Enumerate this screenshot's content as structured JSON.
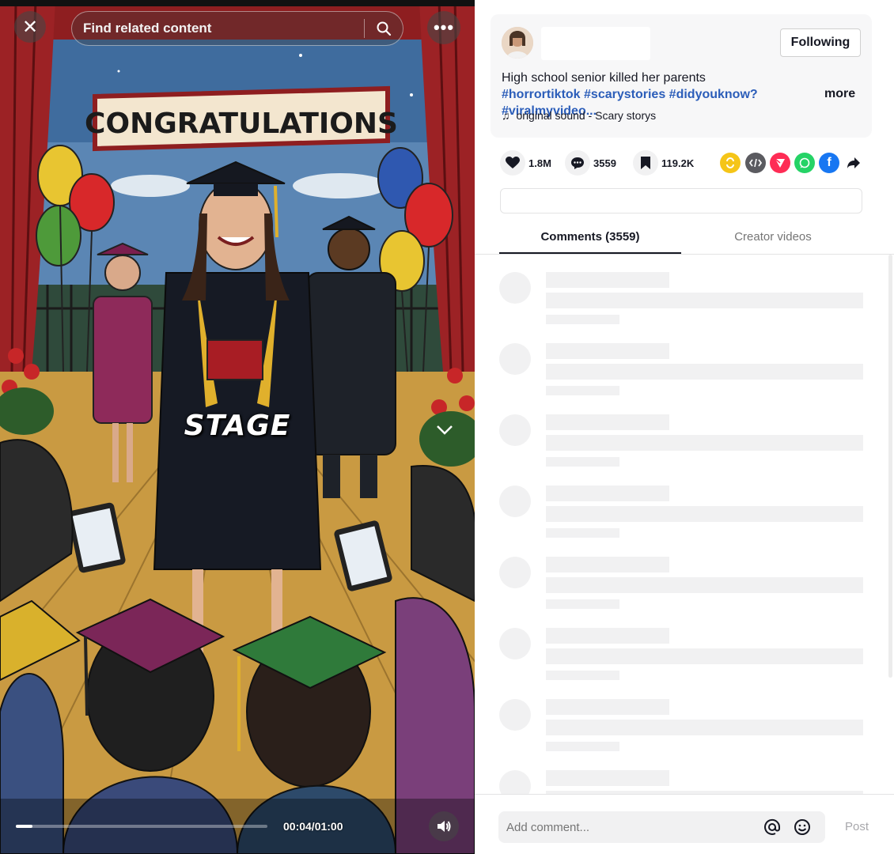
{
  "video": {
    "search_placeholder": "Find related content",
    "caption": "STAGE",
    "time": "00:04/01:00",
    "progress_fraction": 0.067,
    "banner_text": "CONGRATULATIONS",
    "icons": {
      "close": "close-icon",
      "search": "search-icon",
      "more": "more-options-icon",
      "chevron": "chevron-down-icon",
      "volume": "volume-icon"
    }
  },
  "post": {
    "follow_label": "Following",
    "description_text": "High school senior killed her parents ",
    "hashtags": [
      "#horrortiktok",
      "#scarystories",
      "#didyouknow?",
      "#viralmyvideo..."
    ],
    "more_label": "more",
    "music": "original sound - Scary storys",
    "likes": "1.8M",
    "comments": "3559",
    "saves": "119.2K",
    "share_icons": [
      "repost-icon",
      "embed-icon",
      "send-icon",
      "whatsapp-icon",
      "facebook-icon",
      "share-arrow-icon"
    ]
  },
  "tabs": {
    "comments_label": "Comments (3559)",
    "creator_label": "Creator videos"
  },
  "footer": {
    "comment_placeholder": "Add comment...",
    "post_label": "Post"
  },
  "colors": {
    "hashtag": "#2b5db9",
    "skeleton": "#f1f1f2",
    "repost": "#f5c518",
    "embed": "#5b5b60",
    "send": "#fe2c55",
    "whatsapp": "#25d366",
    "facebook": "#1877f2"
  }
}
